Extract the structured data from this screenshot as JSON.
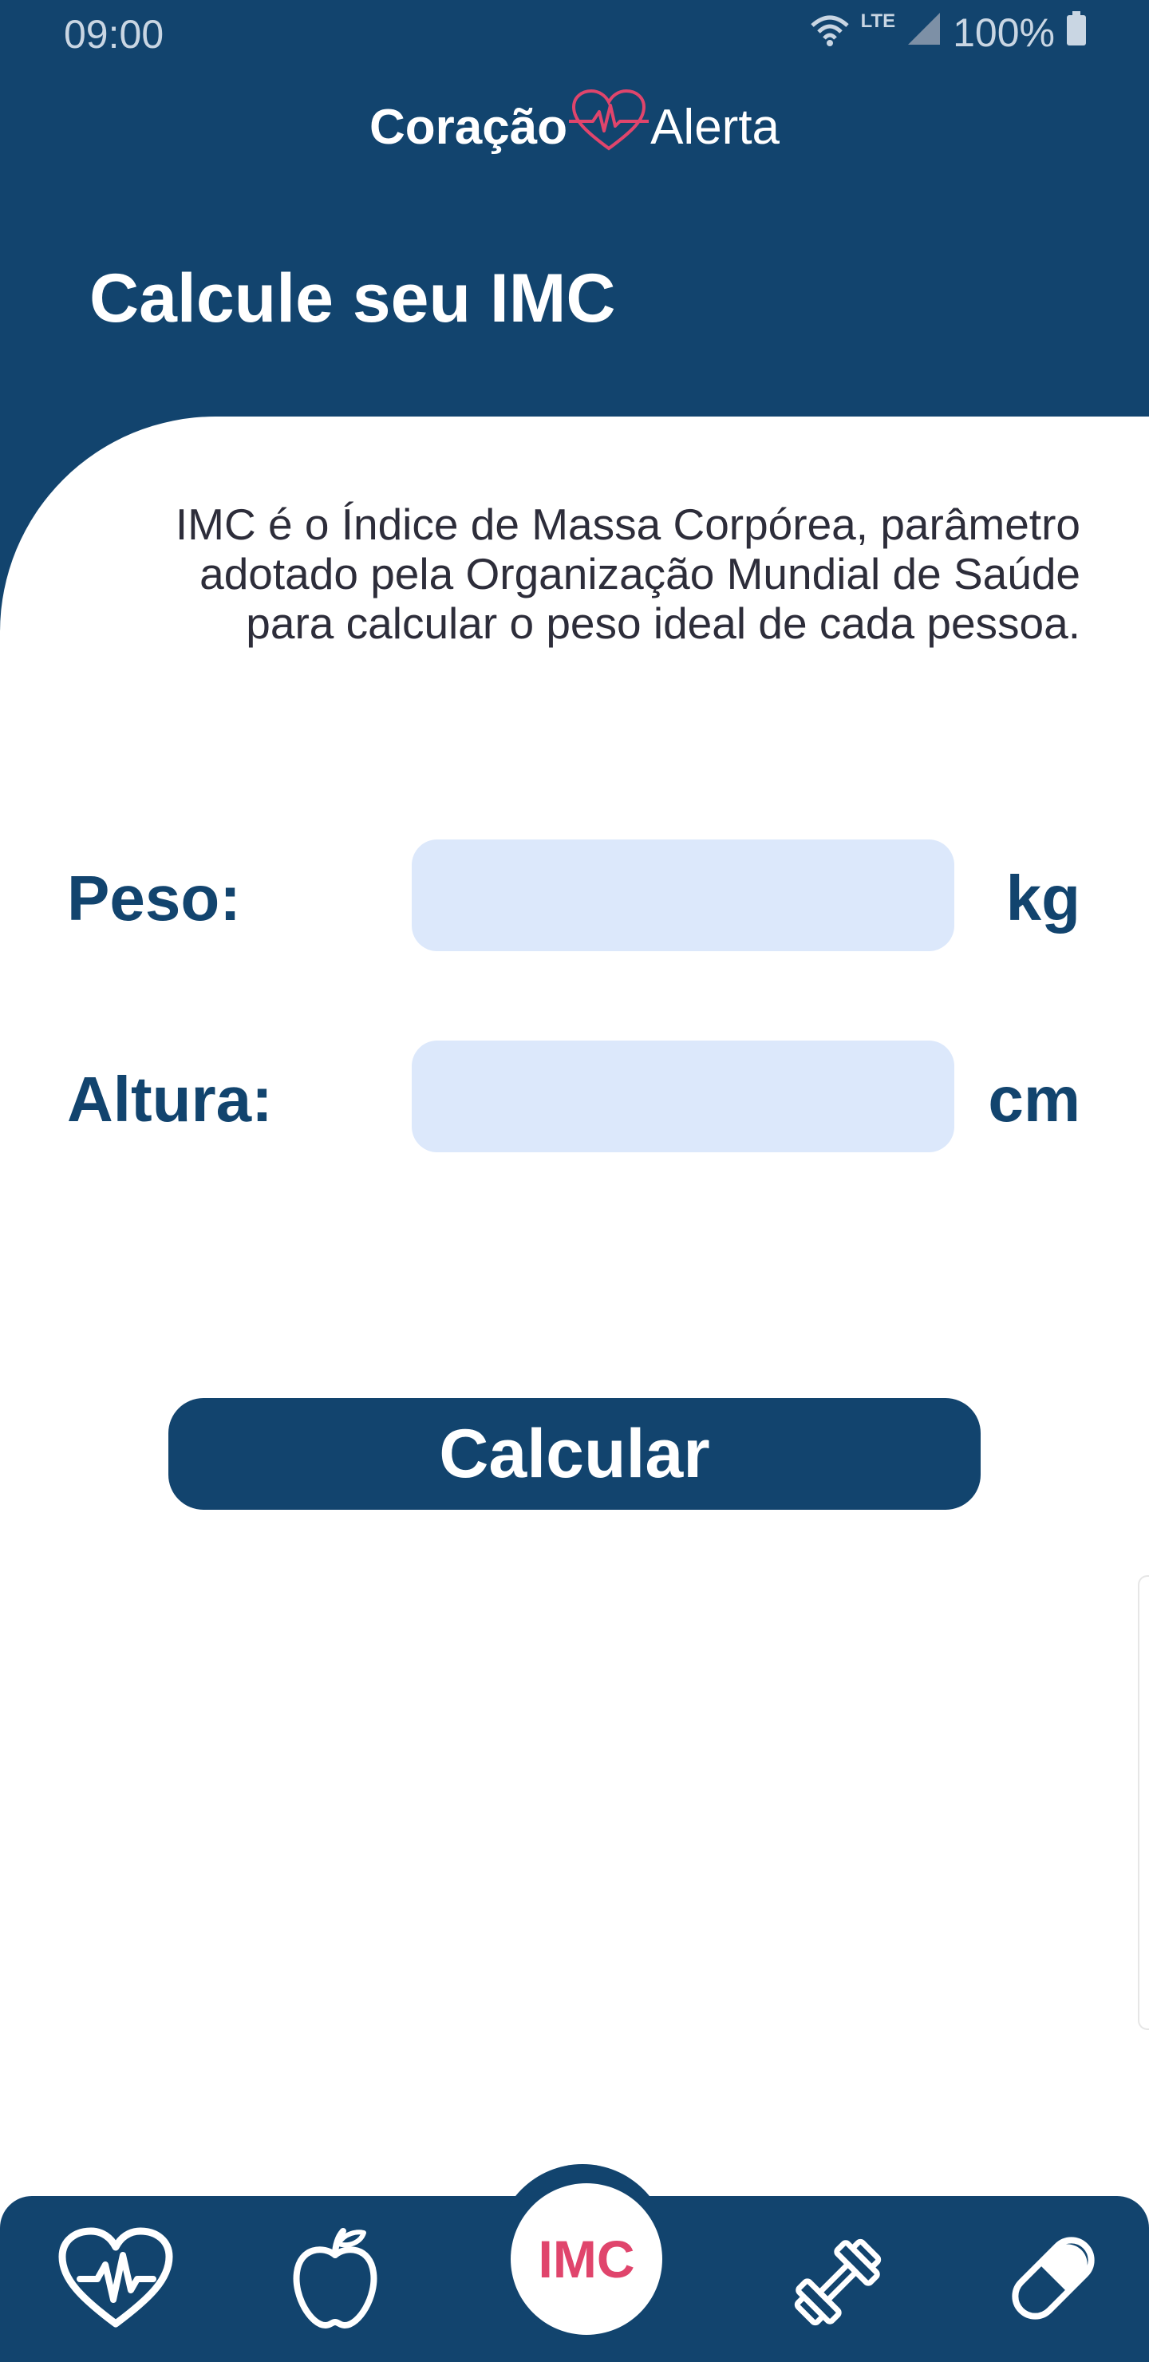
{
  "status_bar": {
    "time": "09:00",
    "network": "LTE",
    "battery": "100%",
    "icons": [
      "wifi-icon",
      "signal-icon",
      "battery-icon"
    ]
  },
  "app": {
    "logo_word1": "Coração",
    "logo_word2": "Alerta",
    "logo_icon": "heart-pulse-icon"
  },
  "page": {
    "title": "Calcule seu IMC",
    "description": "IMC é o Índice de Massa Corpórea, parâmetro adotado pela Organização Mundial de Saúde para calcular o peso ideal de cada pessoa."
  },
  "form": {
    "weight_label": "Peso:",
    "weight_value": "",
    "weight_unit": "kg",
    "height_label": "Altura:",
    "height_value": "",
    "height_unit": "cm",
    "submit_label": "Calcular"
  },
  "nav": {
    "items": [
      {
        "icon": "heart-pulse-icon"
      },
      {
        "icon": "apple-icon"
      },
      {
        "label": "IMC",
        "active": true
      },
      {
        "icon": "dumbbell-icon"
      },
      {
        "icon": "pill-icon"
      }
    ]
  },
  "colors": {
    "primary": "#12446e",
    "accent": "#e0456c",
    "input_bg": "#dce8fb",
    "background": "#ffffff"
  }
}
